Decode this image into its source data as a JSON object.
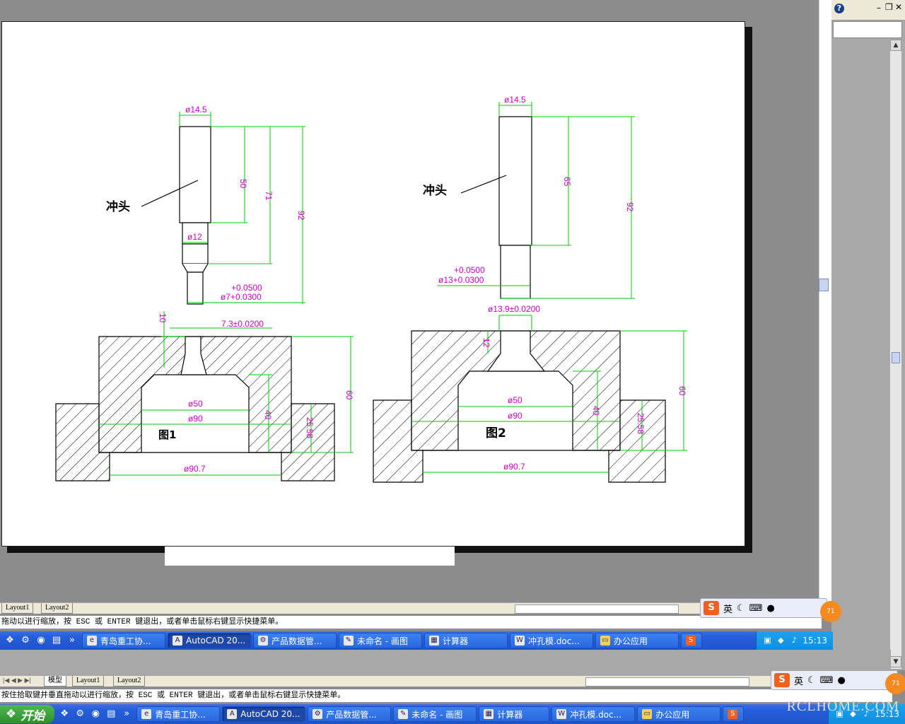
{
  "drawing": {
    "fig1": {
      "label": "图1",
      "punch_label": "冲头",
      "dims": {
        "d_top": "ø14.5",
        "d_mid": "ø12",
        "tol_top": "+0.0500",
        "tol_dia": "ø7+0.0300",
        "len_50": "50",
        "len_71": "71",
        "len_92": "92",
        "depth_10": "10",
        "hole": "7.3±0.0200",
        "d50": "ø50",
        "d90": "ø90",
        "h40": "40",
        "h60": "60",
        "h25": "25.58",
        "d90_7": "ø90.7"
      }
    },
    "fig2": {
      "label": "图2",
      "punch_label": "冲头",
      "dims": {
        "d_top": "ø14.5",
        "len_65": "65",
        "len_92": "92",
        "tol_top": "+0.0500",
        "tol_dia": "ø13+0.0300",
        "hole": "ø13.9±0.0200",
        "depth_12": "12",
        "d50": "ø50",
        "d90": "ø90",
        "h40": "40",
        "h60": "60",
        "h25": "25.58",
        "d90_7": "ø90.7"
      }
    }
  },
  "panel1": {
    "tabs": [
      "Layout1",
      "Layout2"
    ],
    "command": "拖动以进行缩放，按 ESC 或 ENTER 键退出，或者单击鼠标右键显示快捷菜单。",
    "ime": {
      "s": "S",
      "lang": "英",
      "badge": "71"
    },
    "taskbar": {
      "tasks": [
        "青岛重工协...",
        "AutoCAD 20...",
        "产品数据管...",
        "未命名 - 画图",
        "计算器",
        "冲孔模.doc...",
        "办公应用"
      ],
      "clock": "15:13"
    }
  },
  "panel2": {
    "tabs": [
      "模型",
      "Layout1",
      "Layout2"
    ],
    "command": "按住拾取键并垂直拖动以进行缩放，按 ESC 或 ENTER 键退出，或者单击鼠标右键显示快捷菜单。",
    "ime": {
      "s": "S",
      "lang": "英",
      "badge": "71"
    },
    "taskbar": {
      "start": "开始",
      "tasks": [
        "青岛重工协...",
        "AutoCAD 20...",
        "产品数据管...",
        "未命名 - 画图",
        "计算器",
        "冲孔模.doc...",
        "办公应用"
      ],
      "clock": "15:13"
    }
  },
  "watermark": "RCLHOME.COM",
  "colors": {
    "dim": "#00cc00",
    "dimtext": "#cc00cc",
    "taskbar": "#245edb",
    "tray": "#0f8de0",
    "start": "#2d8f2d"
  }
}
